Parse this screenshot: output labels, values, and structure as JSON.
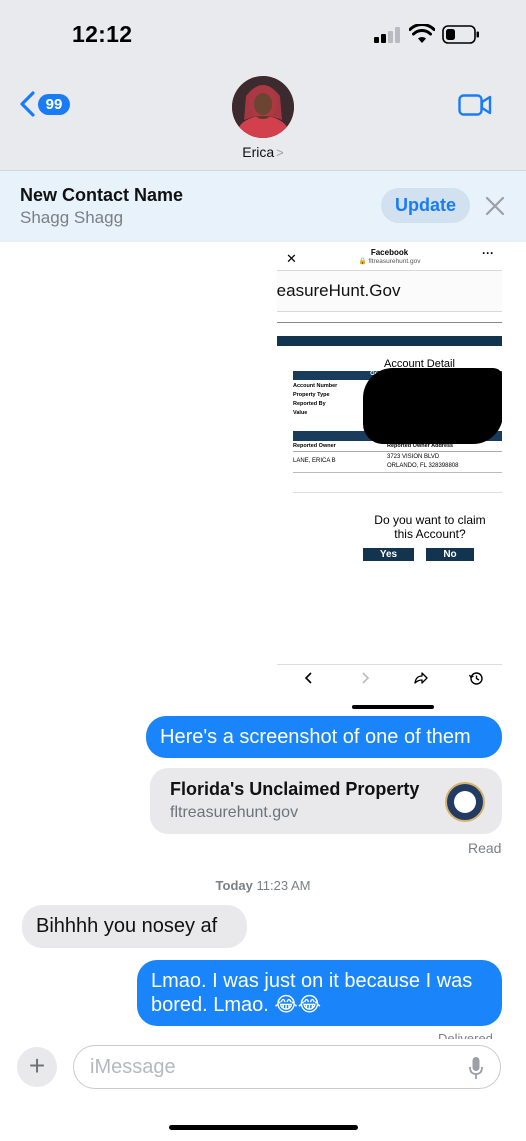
{
  "status_bar": {
    "time": "12:12"
  },
  "header": {
    "back_count": "99",
    "contact_name": "Erica",
    "chevron": ">"
  },
  "contact_banner": {
    "title": "New Contact Name",
    "subtitle": "Shagg Shagg",
    "update_label": "Update"
  },
  "embedded_screenshot": {
    "browser_title": "Facebook",
    "browser_url": "fltreasurehunt.gov",
    "site_heading": "reasureHunt.Gov",
    "account_detail": "Account Detail",
    "table_header": "General Account In",
    "row_labels": [
      "Account Number",
      "Property Type",
      "Reported By",
      "Value"
    ],
    "table_header2": "Re",
    "owner_header": "Reported Owner",
    "owner_address_header": "Reported Owner Address",
    "owner_name": "LANE, ERICA B",
    "owner_address_line1": "3723 VISION BLVD",
    "owner_address_line2": "ORLANDO, FL 328398808",
    "claim_question": "Do you want to claim this Account?",
    "yes_label": "Yes",
    "no_label": "No"
  },
  "messages": {
    "m1": "Here's a screenshot of one of them",
    "link_title": "Florida's Unclaimed Property",
    "link_url": "fltreasurehunt.gov",
    "read_receipt": "Read",
    "timestamp_day": "Today",
    "timestamp_time": "11:23 AM",
    "m2": "Bihhhh you nosey af",
    "m3_line1": "Lmao. I was just on it because I was",
    "m3_line2": "bored. Lmao. 😂😂",
    "delivered": "Delivered"
  },
  "composer": {
    "placeholder": "iMessage",
    "plus": "+"
  },
  "colors": {
    "imessage_blue": "#1a84fa",
    "accent": "#1a7cf5",
    "incoming_gray": "#e9e9eb"
  }
}
